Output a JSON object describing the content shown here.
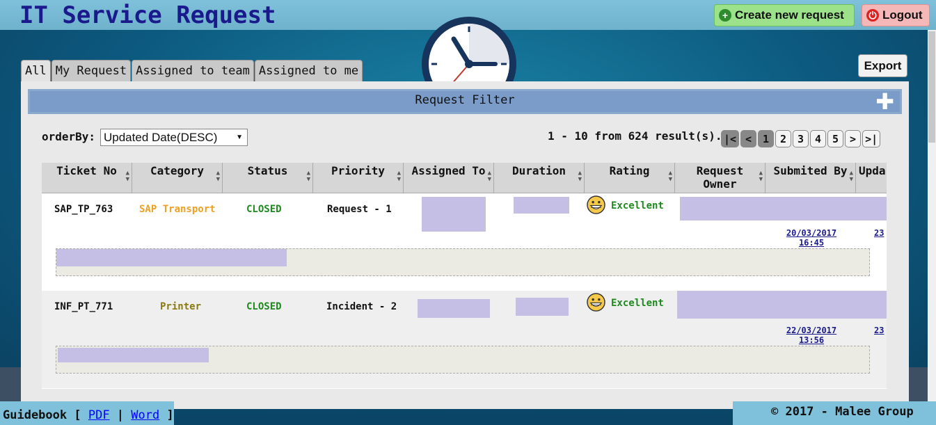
{
  "header": {
    "title": "IT Service Request",
    "create_label": "Create new request",
    "logout_label": "Logout"
  },
  "tabs": [
    {
      "label": "All"
    },
    {
      "label": "My Request"
    },
    {
      "label": "Assigned to team"
    },
    {
      "label": "Assigned to me"
    }
  ],
  "export_label": "Export",
  "filter": {
    "label": "Request Filter"
  },
  "order": {
    "label": "orderBy:",
    "value": "Updated Date(DESC)"
  },
  "results_text": "1 - 10 from 624 result(s).",
  "pager": [
    "|<",
    "<",
    "1",
    "2",
    "3",
    "4",
    "5",
    ">",
    ">|"
  ],
  "table": {
    "headers": [
      "Ticket No",
      "Category",
      "Status",
      "Priority",
      "Assigned To",
      "Duration",
      "Rating",
      "Request Owner",
      "Submited By",
      "Upda"
    ],
    "rows": [
      {
        "ticket": "SAP_TP_763",
        "category": "SAP Transport",
        "category_color": "#f0a020",
        "status": "CLOSED",
        "priority": "Request - 1",
        "rating": "Excellent",
        "date": "20/03/2017",
        "time": "16:45",
        "upd": "23"
      },
      {
        "ticket": "INF_PT_771",
        "category": "Printer",
        "category_color": "#8a7a10",
        "status": "CLOSED",
        "priority": "Incident - 2",
        "rating": "Excellent",
        "date": "22/03/2017",
        "time": "13:56",
        "upd": "23"
      }
    ]
  },
  "footer": {
    "guidebook": "Guidebook",
    "pdf": "PDF",
    "word": "Word",
    "copyright": "© 2017 - Malee Group"
  },
  "colors": {
    "status_closed": "#1e8a1e",
    "rating": "#1e8a1e"
  }
}
